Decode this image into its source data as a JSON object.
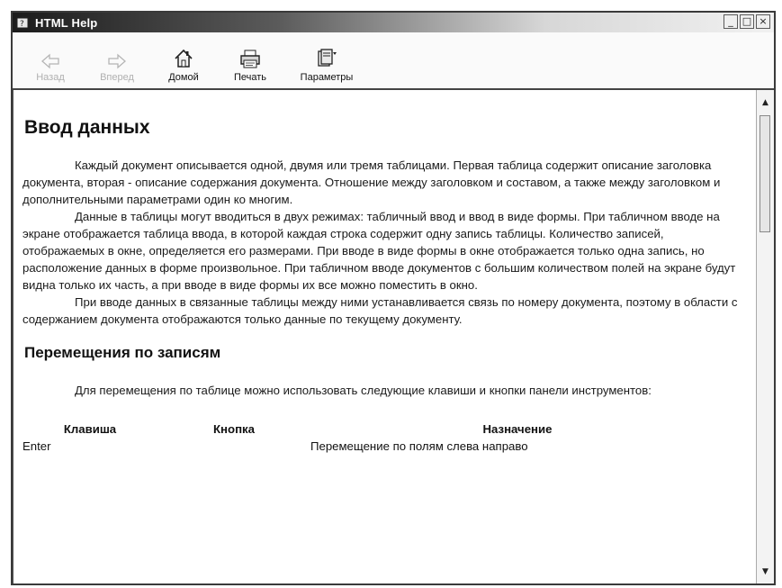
{
  "window": {
    "title": "HTML Help",
    "controls": {
      "minimize": "_",
      "maximize": "□",
      "close": "×"
    }
  },
  "toolbar": {
    "buttons": [
      {
        "id": "back",
        "label": "Назад",
        "icon": "arrow-left-icon",
        "enabled": false
      },
      {
        "id": "forward",
        "label": "Вперед",
        "icon": "arrow-right-icon",
        "enabled": false
      },
      {
        "id": "home",
        "label": "Домой",
        "icon": "home-icon",
        "enabled": true
      },
      {
        "id": "print",
        "label": "Печать",
        "icon": "printer-icon",
        "enabled": true
      },
      {
        "id": "options",
        "label": "Параметры",
        "icon": "options-icon",
        "enabled": true
      }
    ]
  },
  "content": {
    "title": "Ввод данных",
    "paragraphs": [
      "Каждый документ описывается одной, двумя или тремя таблицами.  Первая таблица содержит описание заголовка документа, вторая - описание содержания документа. Отношение между заголовком и составом, а также между заголовком и дополнительными параметрами один ко многим.",
      "Данные в таблицы могут вводиться в двух режимах:  табличный ввод и ввод в виде формы. При табличном вводе на экране отображается таблица ввода, в которой каждая строка содержит одну запись таблицы. Количество записей, отображаемых в окне, определяется его размерами. При вводе в виде формы в окне отображается только одна запись, но расположение данных в форме произвольное. При табличном вводе документов с большим количеством полей на экране будут видна только их часть, а при вводе в виде формы их все можно поместить в окно.",
      "При вводе данных в связанные таблицы между ними устанавливается связь по номеру документа, поэтому в области с содержанием документа отображаются только данные по текущему документу."
    ],
    "section_title": "Перемещения по записям",
    "section_paragraph": "Для перемещения по таблице можно использовать следующие клавиши и кнопки панели инструментов:",
    "table": {
      "headers": {
        "key": "Клавиша",
        "button": "Кнопка",
        "purpose": "Назначение"
      },
      "rows": [
        {
          "key": "Enter",
          "button": "",
          "purpose": "Перемещение по полям слева направо"
        }
      ]
    }
  },
  "scrollbar": {
    "up": "▲",
    "down": "▼"
  }
}
